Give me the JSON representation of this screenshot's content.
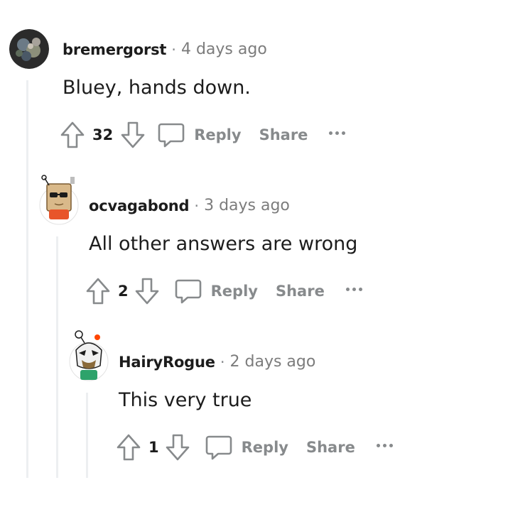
{
  "comments": [
    {
      "author": "bremergorst",
      "separator": "·",
      "time": "4 days ago",
      "body": "Bluey, hands down.",
      "score": "32",
      "reply_label": "Reply",
      "share_label": "Share"
    },
    {
      "author": "ocvagabond",
      "separator": "·",
      "time": "3 days ago",
      "body": "All other answers are wrong",
      "score": "2",
      "reply_label": "Reply",
      "share_label": "Share"
    },
    {
      "author": "HairyRogue",
      "separator": "·",
      "time": "2 days ago",
      "body": "This very true",
      "score": "1",
      "reply_label": "Reply",
      "share_label": "Share"
    }
  ],
  "icons": {
    "upvote": "upvote-icon",
    "downvote": "downvote-icon",
    "reply": "comment-bubble-icon",
    "more": "more-options-icon"
  },
  "colors": {
    "muted": "#878a8c",
    "thread_line": "#edeff1",
    "text": "#1c1c1c"
  }
}
